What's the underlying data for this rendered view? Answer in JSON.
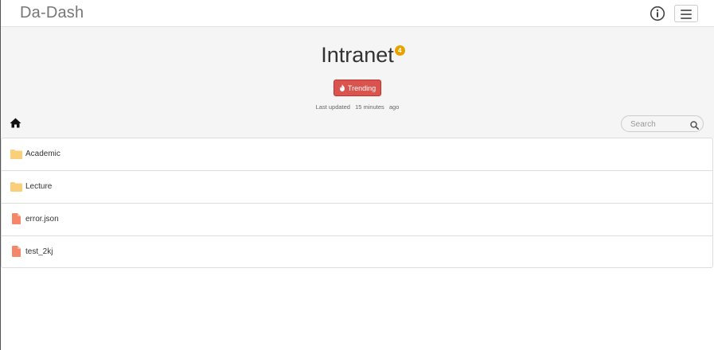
{
  "navbar": {
    "brand": "Da-Dash",
    "info_icon": "info-circle-icon",
    "menu_icon": "hamburger-menu-icon"
  },
  "header": {
    "title": "Intranet",
    "badge_count": "4",
    "trending_label": "Trending",
    "trending_icon": "fire-icon",
    "updated_prefix": "Last updated",
    "updated_value": "15 minutes",
    "updated_suffix": "ago"
  },
  "toolbar": {
    "home_icon": "home-icon",
    "search_placeholder": "Search",
    "search_icon": "magnifier-icon"
  },
  "items": [
    {
      "label": "Academic",
      "type": "folder",
      "icon": "folder-icon"
    },
    {
      "label": "Lecture",
      "type": "folder",
      "icon": "folder-icon"
    },
    {
      "label": "error.json",
      "type": "file",
      "icon": "file-icon"
    },
    {
      "label": "test_2kj",
      "type": "file",
      "icon": "file-icon"
    }
  ],
  "colors": {
    "folder": "#f9cf7a",
    "file": "#f4876a",
    "trending": "#d9534f",
    "badge": "#e8a200",
    "header_bg": "#f5f5f5"
  }
}
